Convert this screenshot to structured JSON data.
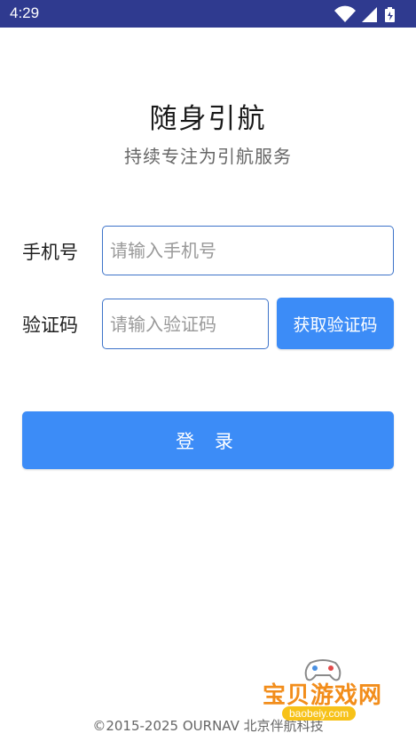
{
  "status_bar": {
    "time": "4:29",
    "icons": [
      "wifi-icon",
      "signal-icon",
      "battery-icon"
    ],
    "color": "#2f3a8f"
  },
  "header": {
    "title": "随身引航",
    "subtitle": "持续专注为引航服务"
  },
  "form": {
    "phone": {
      "label": "手机号",
      "placeholder": "请输入手机号"
    },
    "code": {
      "label": "验证码",
      "placeholder": "请输入验证码",
      "button_label": "获取验证码"
    },
    "login_label": "登 录",
    "accent_color": "#3c8cf7"
  },
  "footer": {
    "text": "©2015-2025 OURNAV 北京伴航科技"
  },
  "watermark": {
    "text": "宝贝游戏网",
    "url": "baobeiy.com"
  }
}
